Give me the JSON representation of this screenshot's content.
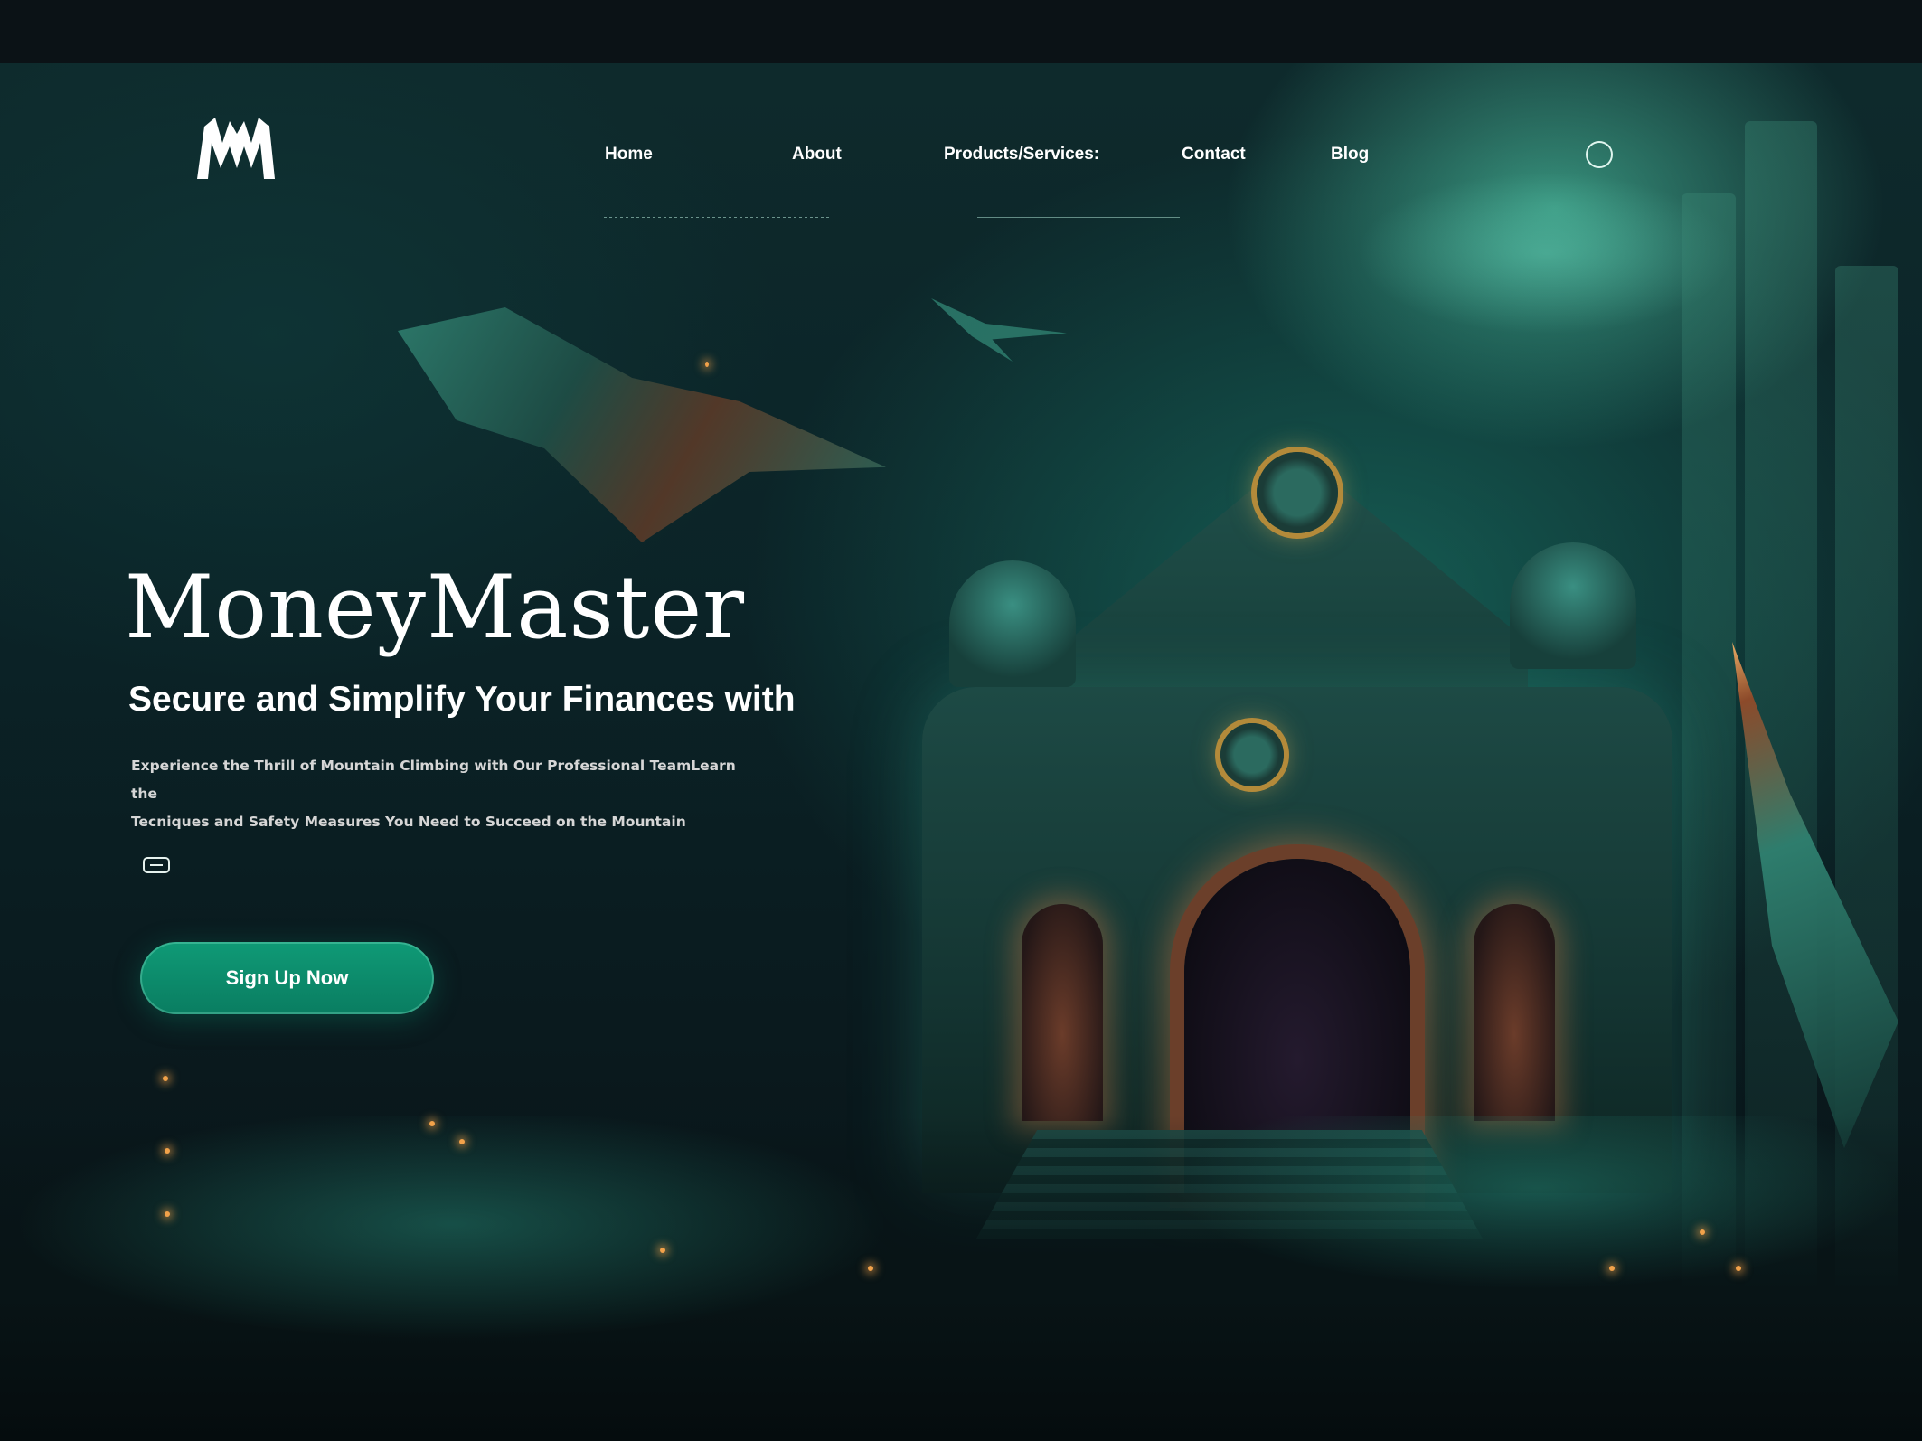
{
  "brand": {
    "logo_text": "MM",
    "accent_color": "#0f9a76"
  },
  "nav": {
    "items": [
      {
        "label": "Home"
      },
      {
        "label": "About"
      },
      {
        "label": "Products/Services:"
      },
      {
        "label": "Contact"
      },
      {
        "label": "Blog"
      }
    ],
    "search_icon": "search-icon"
  },
  "hero": {
    "title": "MoneyMaster",
    "subtitle": "Secure and Simplify Your Finances with",
    "description_line1": "Experience the Thrill of Mountain Climbing with Our Professional TeamLearn the",
    "description_line2": "Tecniques and Safety Measures You Need to Succeed on the Mountain",
    "small_icon": "card-icon",
    "cta_label": "Sign Up Now"
  }
}
